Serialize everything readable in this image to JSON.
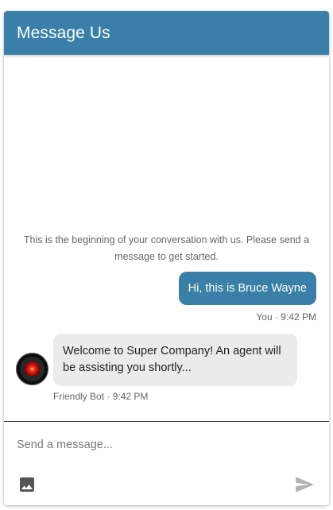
{
  "header": {
    "title": "Message Us"
  },
  "conversation": {
    "intro_text": "This is the beginning of your conversation with us. Please send a message to get started.",
    "messages": [
      {
        "sender": "You",
        "time": "9:42 PM",
        "meta": "You · 9:42 PM",
        "text": "Hi, this is Bruce Wayne",
        "direction": "outgoing"
      },
      {
        "sender": "Friendly Bot",
        "time": "9:42 PM",
        "meta": "Friendly Bot · 9:42 PM",
        "text": "Welcome to Super Company! An agent will be assisting you shortly...",
        "direction": "incoming",
        "avatar": "bot-avatar-red-eye"
      }
    ]
  },
  "composer": {
    "placeholder": "Send a message...",
    "value": "",
    "image_icon": "image-icon",
    "send_icon": "send-icon"
  },
  "colors": {
    "brand": "#3a7fa8",
    "incoming_bubble": "#ebebeb",
    "meta_text": "#666666"
  }
}
